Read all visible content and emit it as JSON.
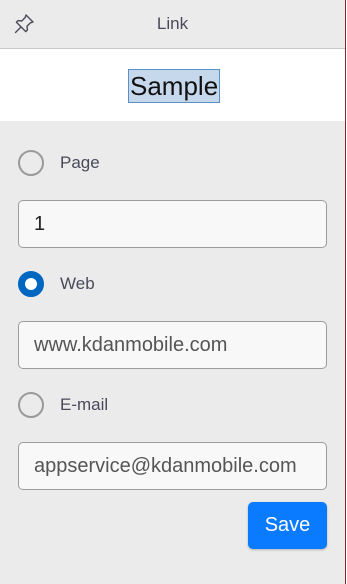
{
  "header": {
    "title": "Link",
    "pin_icon": "pin-icon"
  },
  "preview": {
    "sample_text": "Sample"
  },
  "options": {
    "page": {
      "label": "Page",
      "checked": false,
      "value": "1"
    },
    "web": {
      "label": "Web",
      "checked": true,
      "value": "www.kdanmobile.com"
    },
    "email": {
      "label": "E-mail",
      "checked": false,
      "value": "appservice@kdanmobile.com"
    }
  },
  "actions": {
    "save_label": "Save"
  },
  "colors": {
    "accent": "#0067c0",
    "button": "#0a7bff",
    "panel_bg": "#ebebeb"
  }
}
